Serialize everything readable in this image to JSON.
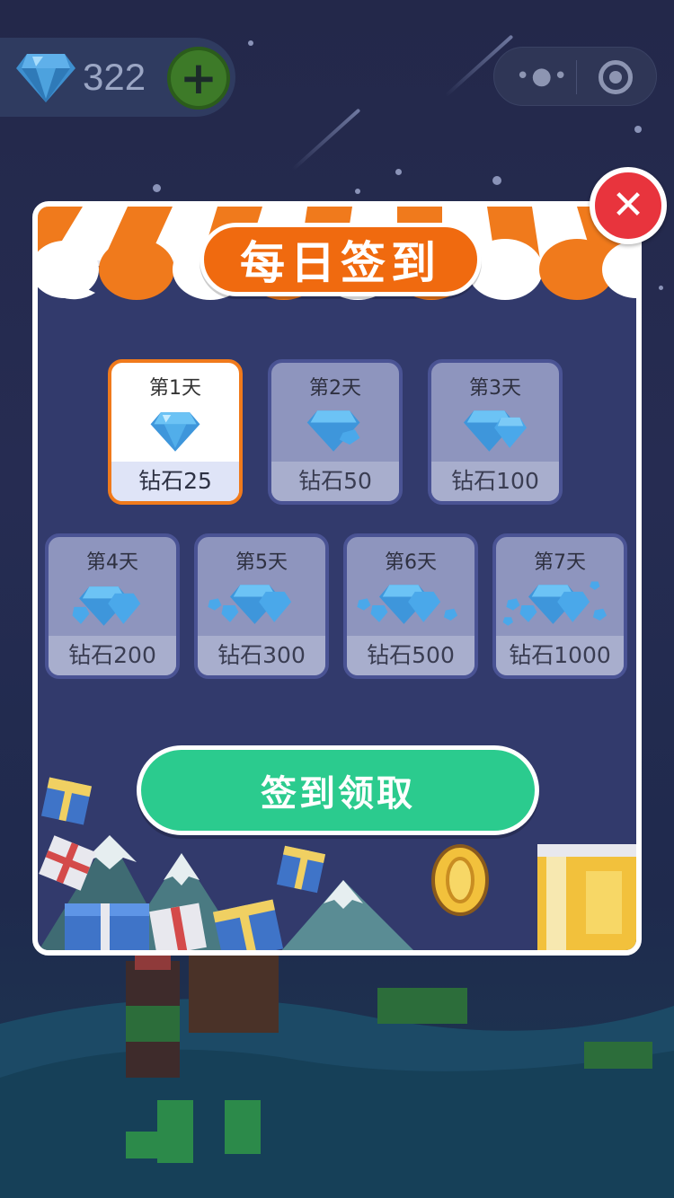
{
  "top_bar": {
    "currency_icon": "diamond-icon",
    "currency_value": "322",
    "add_icon": "plus-icon",
    "menu_icon": "more-dots-icon",
    "close_icon": "target-icon"
  },
  "modal": {
    "title": "每日签到",
    "close_icon": "close-x-icon",
    "days": [
      {
        "day": "第1天",
        "reward": "钻石25",
        "active": true
      },
      {
        "day": "第2天",
        "reward": "钻石50",
        "active": false
      },
      {
        "day": "第3天",
        "reward": "钻石100",
        "active": false
      },
      {
        "day": "第4天",
        "reward": "钻石200",
        "active": false
      },
      {
        "day": "第5天",
        "reward": "钻石300",
        "active": false
      },
      {
        "day": "第6天",
        "reward": "钻石500",
        "active": false
      },
      {
        "day": "第7天",
        "reward": "钻石1000",
        "active": false
      }
    ],
    "claim_label": "签到领取"
  },
  "colors": {
    "background": "#262c52",
    "modal": "#323a6c",
    "awning_orange": "#f07a1c",
    "title_pill": "#f06a0f",
    "claim_green": "#2bcb8e",
    "close_red": "#e8343d",
    "gem_blue": "#4aa8ea"
  }
}
